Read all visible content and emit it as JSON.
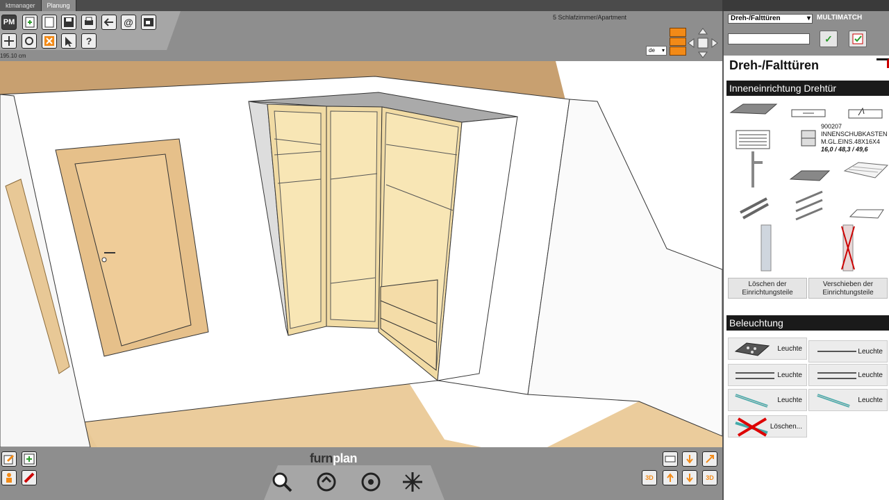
{
  "tabs": [
    {
      "label": "ktmanager"
    },
    {
      "label": "Planung"
    }
  ],
  "toolbar": {
    "pm_label": "PM",
    "breadcrumb": "5  Schlafzimmer/Apartment",
    "measure": "195.10 cm",
    "language": "de"
  },
  "icons": {
    "pm": "pm-icon",
    "new": "new-document-icon",
    "page": "page-icon",
    "save": "save-icon",
    "print": "print-icon",
    "back": "back-arrow-icon",
    "email": "at-icon",
    "export": "export-icon",
    "move": "move-icon",
    "rotate": "rotate-icon",
    "delete": "delete-icon",
    "select": "cursor-icon",
    "help": "help-icon"
  },
  "bottom": {
    "logo_part1": "furn",
    "logo_part2": "plan",
    "labels_3d": [
      "3D",
      "3D"
    ]
  },
  "right_panel": {
    "category_select": "Dreh-/Falttüren",
    "multimatch": "MULTIMATCH",
    "title": "Dreh-/Falttüren",
    "section_interior": "Inneneinrichtung Drehtür",
    "item_info": {
      "code": "900207",
      "name": "INNENSCHUBKASTEN",
      "desc": "M.GL.EINS.48X16X4",
      "dims": "16,0 / 48,3 / 49,6"
    },
    "btn_delete_parts": "Löschen der Einrichtungsteile",
    "btn_move_parts": "Verschieben der Einrichtungsteile",
    "section_lighting": "Beleuchtung",
    "lights": [
      "Leuchte",
      "Leuchte",
      "Leuchte",
      "Leuchte",
      "Leuchte",
      "Leuchte"
    ],
    "delete_light": "Löschen..."
  },
  "colors": {
    "accent": "#f28a17",
    "panel_dark": "#1a1a1a",
    "toolbar": "#8e8e8e"
  }
}
